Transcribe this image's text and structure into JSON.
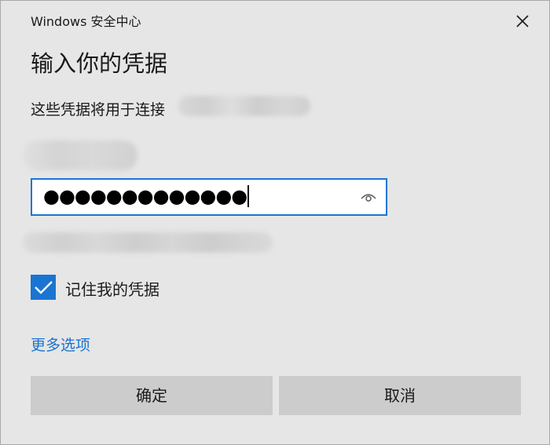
{
  "window": {
    "app_title": "Windows 安全中心"
  },
  "dialog": {
    "heading": "输入你的凭据",
    "subtitle": "这些凭据将用于连接",
    "password": {
      "value": "●●●●●●●●●●●●●",
      "reveal_icon": "eye-icon"
    },
    "remember": {
      "checked": true,
      "label": "记住我的凭据"
    },
    "more_options_link": "更多选项",
    "buttons": {
      "ok": "确定",
      "cancel": "取消"
    }
  },
  "colors": {
    "accent": "#1a75d2",
    "link": "#1a73d0",
    "background": "#e6e6e6",
    "button": "#cccccc"
  }
}
